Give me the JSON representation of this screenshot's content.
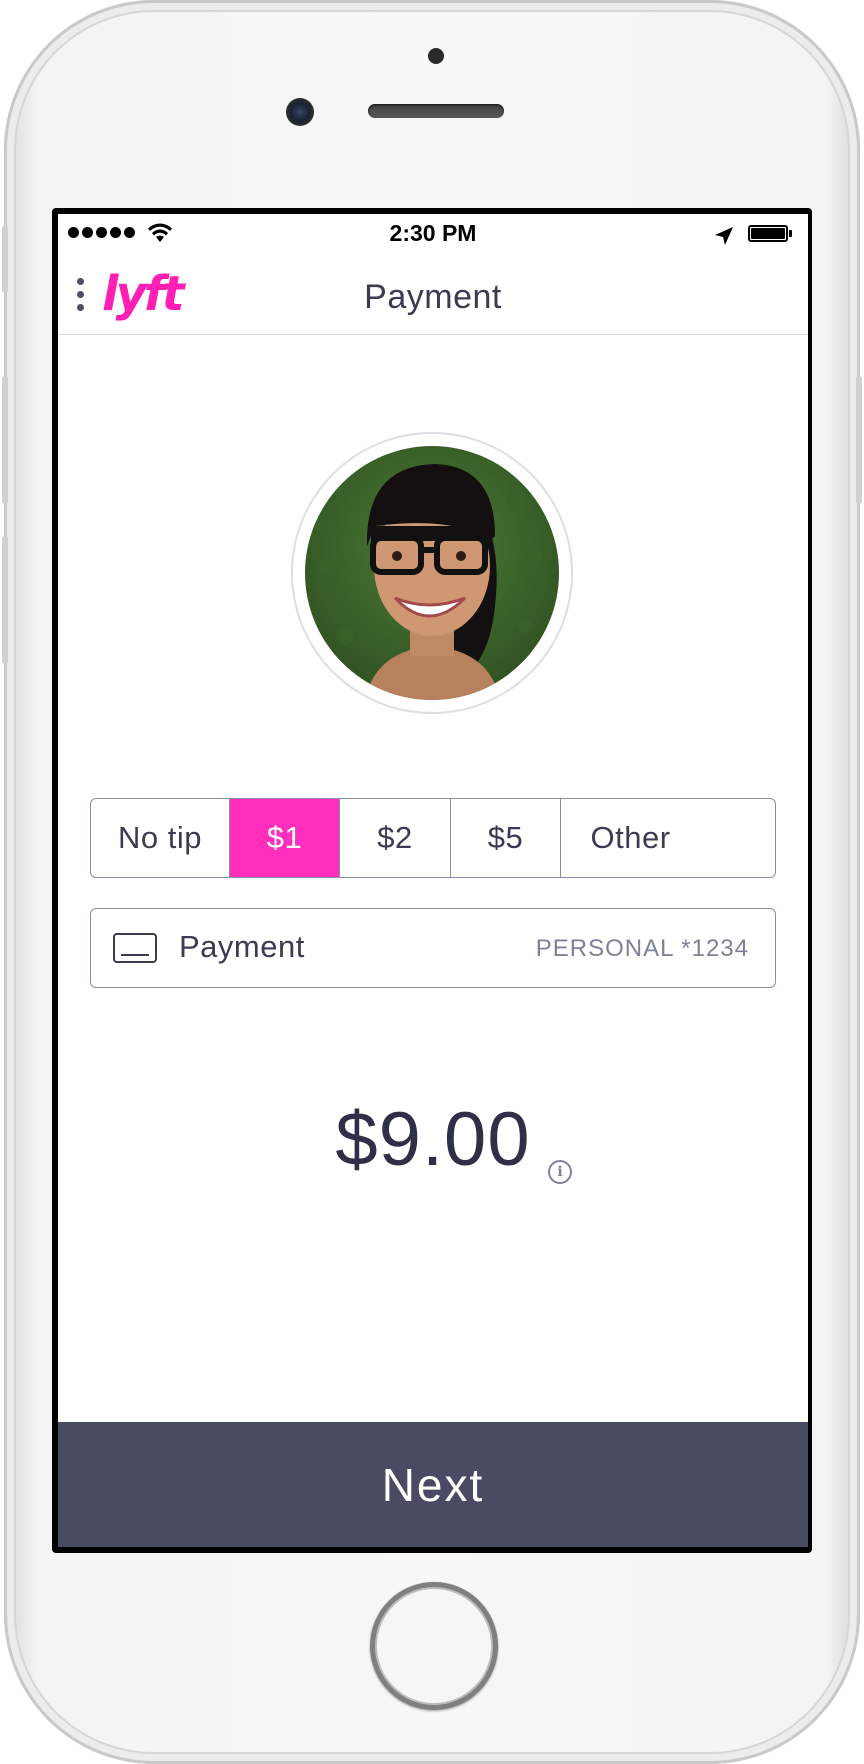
{
  "status_bar": {
    "time": "2:30 PM"
  },
  "header": {
    "logo": "lyft",
    "title": "Payment"
  },
  "profile": {
    "photo": "driver-photo"
  },
  "tips": {
    "options": [
      "No tip",
      "$1",
      "$2",
      "$5",
      "Other"
    ],
    "selected": "$1"
  },
  "payment": {
    "label": "Payment",
    "value": "PERSONAL *1234"
  },
  "total": {
    "amount": "$9.00",
    "info_icon": "i"
  },
  "actions": {
    "next_label": "Next"
  },
  "colors": {
    "brand": "#ff2ebd",
    "button": "#484b62",
    "text": "#3b3c52"
  }
}
